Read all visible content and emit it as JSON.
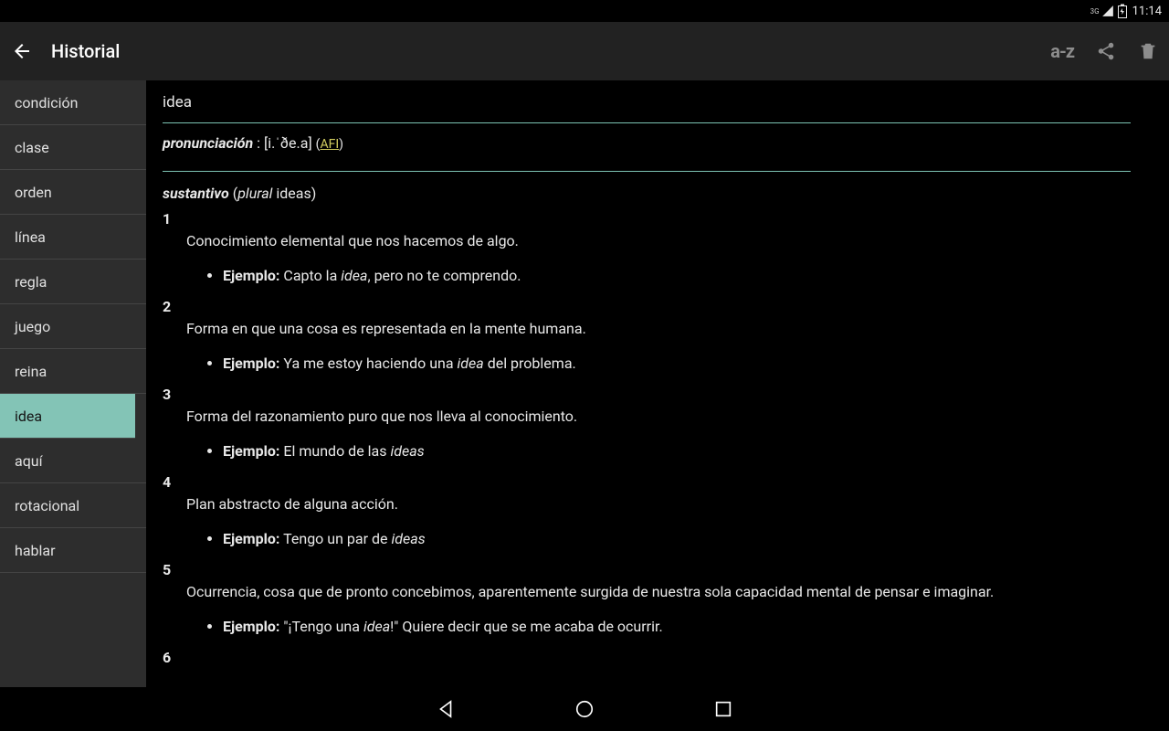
{
  "status": {
    "network_label": "3G",
    "time": "11:14"
  },
  "appbar": {
    "title": "Historial",
    "sort_label": "a-z"
  },
  "sidebar": {
    "items": [
      {
        "label": "condición",
        "active": false
      },
      {
        "label": "clase",
        "active": false
      },
      {
        "label": "orden",
        "active": false
      },
      {
        "label": "línea",
        "active": false
      },
      {
        "label": "regla",
        "active": false
      },
      {
        "label": "juego",
        "active": false
      },
      {
        "label": "reina",
        "active": false
      },
      {
        "label": "idea",
        "active": true
      },
      {
        "label": "aquí",
        "active": false
      },
      {
        "label": "rotacional",
        "active": false
      },
      {
        "label": "hablar",
        "active": false
      }
    ]
  },
  "entry": {
    "headword": "idea",
    "pron": {
      "label": "pronunciación",
      "sep": " : ",
      "ipa": "[i.ˈðe.a]",
      "afi": "AFI"
    },
    "pos": {
      "name": "sustantivo",
      "plural_word": "plural",
      "plural_form": "ideas"
    },
    "senses": [
      {
        "num": "1",
        "def": "Conocimiento elemental que nos hacemos de algo.",
        "example_label": "Ejemplo:",
        "example_pre": " Capto la ",
        "example_italic": "idea",
        "example_post": ", pero no te comprendo."
      },
      {
        "num": "2",
        "def": "Forma en que una cosa es representada en la mente humana.",
        "example_label": "Ejemplo:",
        "example_pre": " Ya me estoy haciendo una ",
        "example_italic": "idea",
        "example_post": " del problema."
      },
      {
        "num": "3",
        "def": "Forma del razonamiento puro que nos lleva al conocimiento.",
        "example_label": "Ejemplo:",
        "example_pre": " El mundo de las ",
        "example_italic": "ideas",
        "example_post": ""
      },
      {
        "num": "4",
        "def": "Plan abstracto de alguna acción.",
        "example_label": "Ejemplo:",
        "example_pre": " Tengo un par de ",
        "example_italic": "ideas",
        "example_post": ""
      },
      {
        "num": "5",
        "def": "Ocurrencia, cosa que de pronto concebimos, aparentemente surgida de nuestra sola capacidad mental de pensar e imaginar.",
        "example_label": "Ejemplo:",
        "example_pre": " \"¡Tengo una ",
        "example_italic": "idea",
        "example_post": "!\" Quiere decir que se me acaba de ocurrir."
      },
      {
        "num": "6",
        "def": "",
        "example_label": "",
        "example_pre": "",
        "example_italic": "",
        "example_post": ""
      }
    ]
  }
}
